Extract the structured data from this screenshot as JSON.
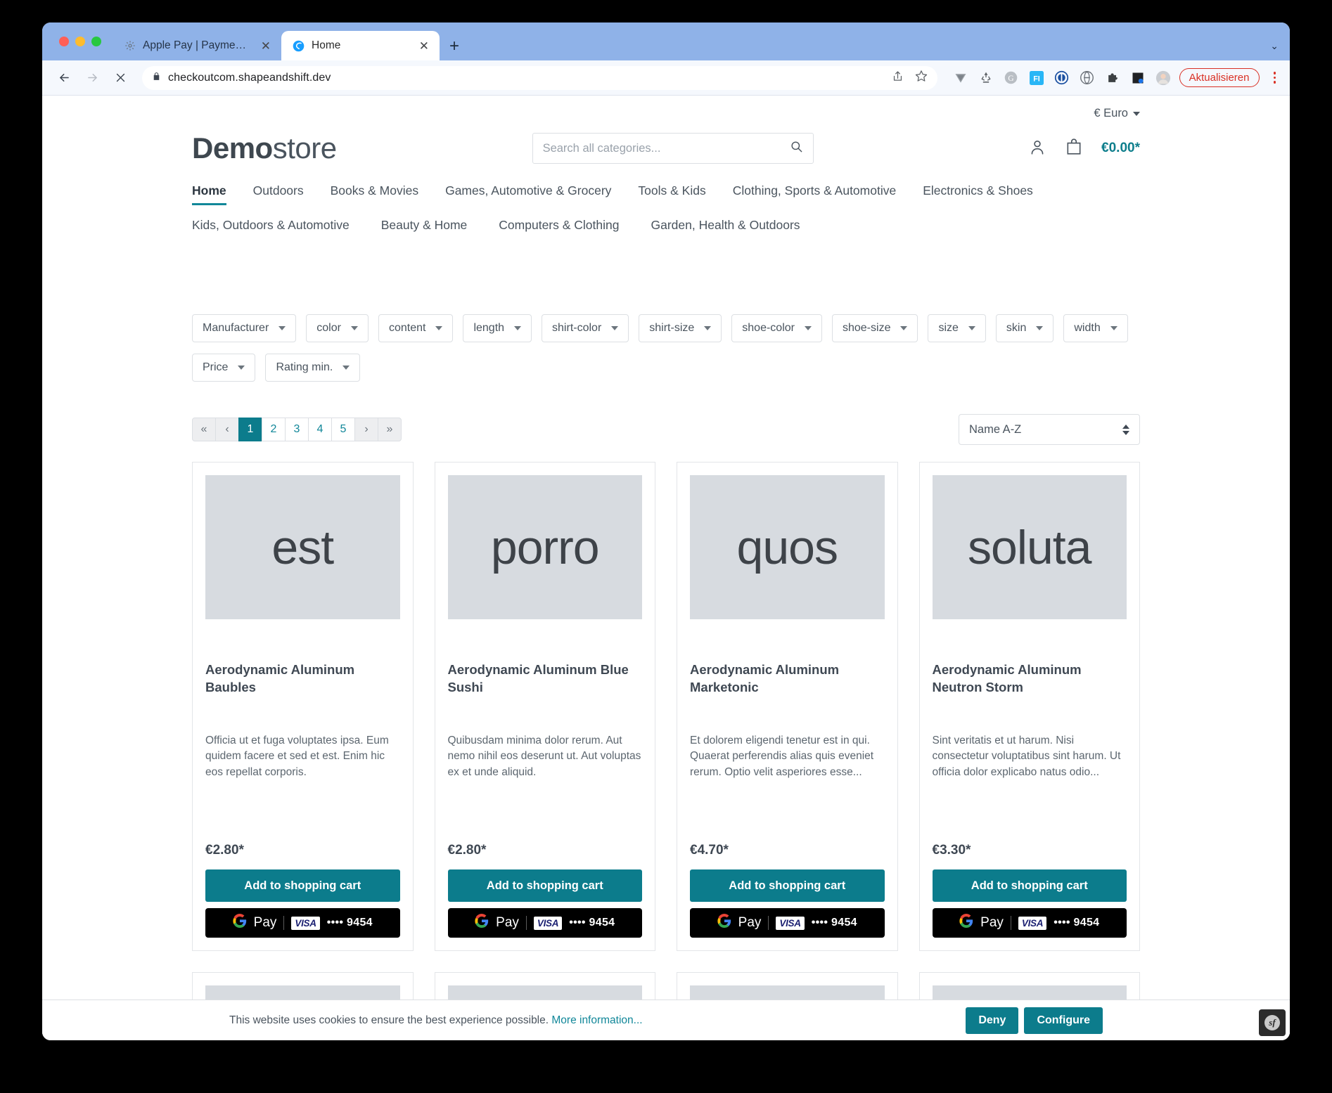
{
  "browser": {
    "tabs": [
      {
        "title": "Apple Pay | Payment methods",
        "favicon": "gear-icon",
        "active": false
      },
      {
        "title": "Home",
        "favicon": "shopware-icon",
        "active": true
      }
    ],
    "new_tab_label": "+",
    "url": "checkoutcom.shapeandshift.dev",
    "lock_icon": "lock-icon",
    "back_icon": "back-arrow-icon",
    "forward_icon": "forward-arrow-icon",
    "stop_icon": "stop-x-icon",
    "share_icon": "share-icon",
    "bookmark_icon": "star-icon",
    "update_label": "Aktualisieren",
    "extensions": [
      "v-icon",
      "recycle-icon",
      "grammarly-g-icon",
      "fi-icon",
      "onepassword-icon",
      "dashlane-icon",
      "puzzle-icon",
      "window-icon",
      "profile-avatar-icon"
    ]
  },
  "topbar": {
    "currency": "€ Euro"
  },
  "header": {
    "logo_bold": "Demo",
    "logo_light": "store",
    "search_placeholder": "Search all categories...",
    "search_value": "",
    "search_icon": "search-icon",
    "account_icon": "user-icon",
    "cart_icon": "bag-icon",
    "cart_total": "€0.00*"
  },
  "nav": {
    "row1": [
      {
        "label": "Home",
        "active": true
      },
      {
        "label": "Outdoors",
        "active": false
      },
      {
        "label": "Books & Movies",
        "active": false
      },
      {
        "label": "Games, Automotive & Grocery",
        "active": false
      },
      {
        "label": "Tools & Kids",
        "active": false
      },
      {
        "label": "Clothing, Sports & Automotive",
        "active": false
      },
      {
        "label": "Electronics & Shoes",
        "active": false
      }
    ],
    "row2": [
      {
        "label": "Kids, Outdoors & Automotive"
      },
      {
        "label": "Beauty & Home"
      },
      {
        "label": "Computers & Clothing"
      },
      {
        "label": "Garden, Health & Outdoors"
      }
    ]
  },
  "filters": {
    "row1": [
      "Manufacturer",
      "color",
      "content",
      "length",
      "shirt-color",
      "shirt-size",
      "shoe-color",
      "shoe-size",
      "size",
      "skin",
      "width"
    ],
    "row2": [
      "Price",
      "Rating min."
    ]
  },
  "listing": {
    "pagination": [
      "«",
      "‹",
      "1",
      "2",
      "3",
      "4",
      "5",
      "›",
      "»"
    ],
    "current_page": "1",
    "sort_selected": "Name A-Z"
  },
  "products": [
    {
      "placeholder_text": "est",
      "title": "Aerodynamic Aluminum Baubles",
      "description": "Officia ut et fuga voluptates ipsa. Eum quidem facere et sed et est. Enim hic eos repellat corporis.",
      "price": "€2.80*",
      "cart_label": "Add to shopping cart",
      "gpay_label": "Pay",
      "card_brand": "VISA",
      "card_number": "•••• 9454"
    },
    {
      "placeholder_text": "porro",
      "title": "Aerodynamic Aluminum Blue Sushi",
      "description": "Quibusdam minima dolor rerum. Aut nemo nihil eos deserunt ut. Aut voluptas ex et unde aliquid.",
      "price": "€2.80*",
      "cart_label": "Add to shopping cart",
      "gpay_label": "Pay",
      "card_brand": "VISA",
      "card_number": "•••• 9454"
    },
    {
      "placeholder_text": "quos",
      "title": "Aerodynamic Aluminum Marketonic",
      "description": "Et dolorem eligendi tenetur est in qui. Quaerat perferendis alias quis eveniet rerum. Optio velit asperiores esse...",
      "price": "€4.70*",
      "cart_label": "Add to shopping cart",
      "gpay_label": "Pay",
      "card_brand": "VISA",
      "card_number": "•••• 9454"
    },
    {
      "placeholder_text": "soluta",
      "title": "Aerodynamic Aluminum Neutron Storm",
      "description": "Sint veritatis et ut harum. Nisi consectetur voluptatibus sint harum. Ut officia dolor explicabo natus odio...",
      "price": "€3.30*",
      "cart_label": "Add to shopping cart",
      "gpay_label": "Pay",
      "card_brand": "VISA",
      "card_number": "•••• 9454"
    }
  ],
  "cookie": {
    "text": "This website uses cookies to ensure the best experience possible.",
    "link": "More information...",
    "deny_label": "Deny",
    "configure_label": "Configure"
  },
  "colors": {
    "accent": "#0c7c8c",
    "link": "#118799",
    "text": "#4a545e",
    "placeholder_bg": "#d7dbe0"
  }
}
